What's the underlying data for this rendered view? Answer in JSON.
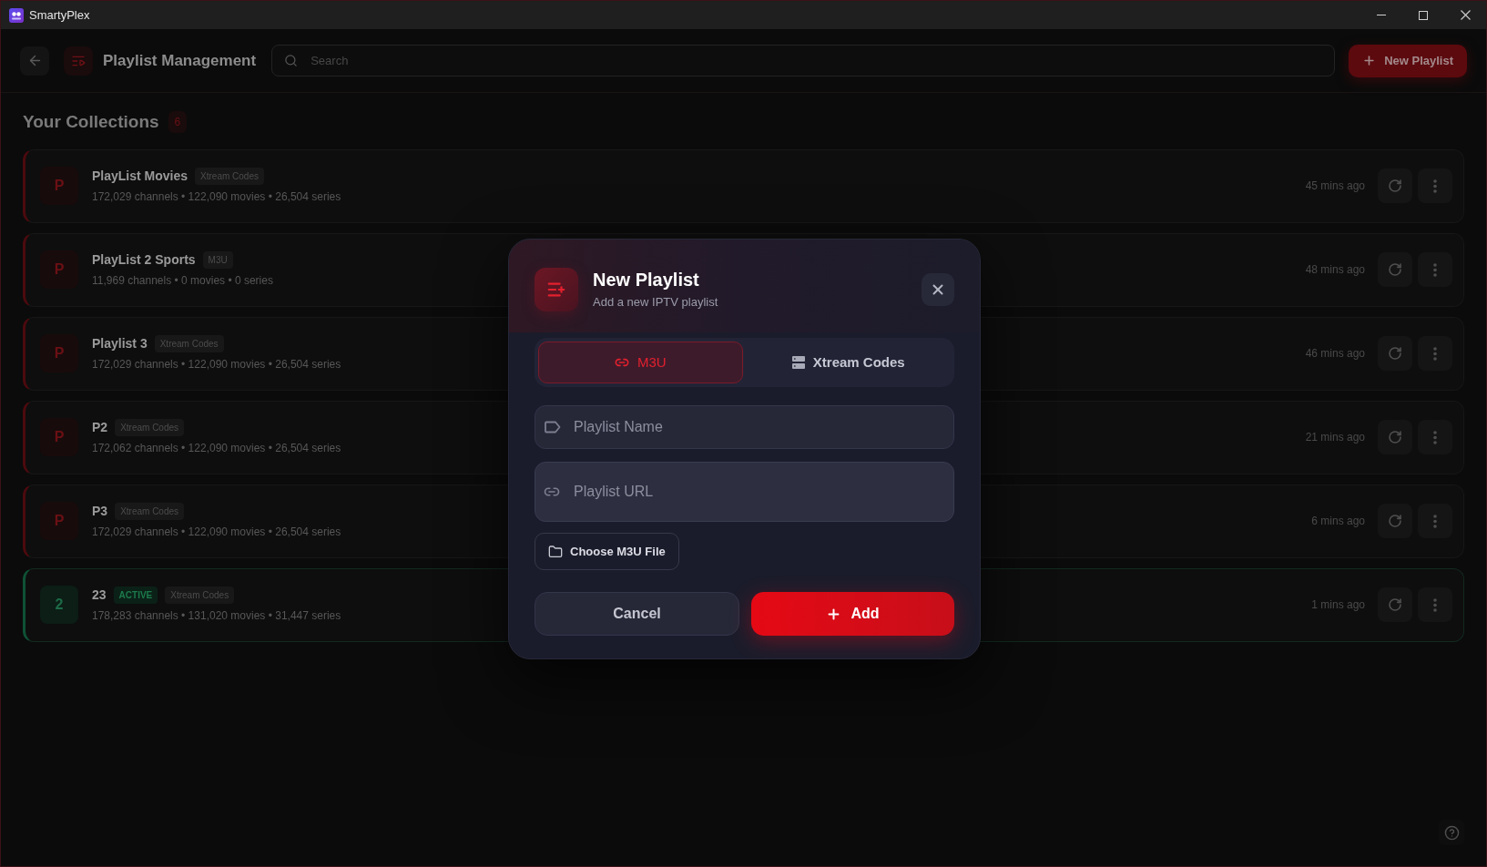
{
  "window": {
    "title": "SmartyPlex"
  },
  "header": {
    "title": "Playlist Management",
    "search": {
      "placeholder": "Search"
    },
    "new_playlist_button": {
      "label": "New Playlist"
    }
  },
  "collections": {
    "title": "Your Collections",
    "count": "6",
    "items": [
      {
        "avatar": "P",
        "name": "PlayList Movies",
        "active": false,
        "badges": [
          {
            "kind": "type",
            "label": "Xtream Codes"
          }
        ],
        "stats": "172,029 channels • 122,090 movies • 26,504 series",
        "updated": "45 mins ago"
      },
      {
        "avatar": "P",
        "name": "PlayList 2 Sports",
        "active": false,
        "badges": [
          {
            "kind": "type",
            "label": "M3U"
          }
        ],
        "stats": "11,969 channels • 0 movies • 0 series",
        "updated": "48 mins ago"
      },
      {
        "avatar": "P",
        "name": "Playlist 3",
        "active": false,
        "badges": [
          {
            "kind": "type",
            "label": "Xtream Codes"
          }
        ],
        "stats": "172,029 channels • 122,090 movies • 26,504 series",
        "updated": "46 mins ago"
      },
      {
        "avatar": "P",
        "name": "P2",
        "active": false,
        "badges": [
          {
            "kind": "type",
            "label": "Xtream Codes"
          }
        ],
        "stats": "172,062 channels • 122,090 movies • 26,504 series",
        "updated": "21 mins ago"
      },
      {
        "avatar": "P",
        "name": "P3",
        "active": false,
        "badges": [
          {
            "kind": "type",
            "label": "Xtream Codes"
          }
        ],
        "stats": "172,029 channels • 122,090 movies • 26,504 series",
        "updated": "6 mins ago"
      },
      {
        "avatar": "2",
        "name": "23",
        "active": true,
        "badges": [
          {
            "kind": "status",
            "label": "ACTIVE"
          },
          {
            "kind": "type",
            "label": "Xtream Codes"
          }
        ],
        "stats": "178,283 channels • 131,020 movies • 31,447 series",
        "updated": "1 mins ago"
      }
    ]
  },
  "modal": {
    "title": "New Playlist",
    "subtitle": "Add a new IPTV playlist",
    "tabs": [
      {
        "label": "M3U",
        "selected": true
      },
      {
        "label": "Xtream Codes",
        "selected": false
      }
    ],
    "fields": [
      {
        "kind": "single",
        "placeholder": "Playlist Name"
      },
      {
        "kind": "tall",
        "placeholder": "Playlist URL"
      }
    ],
    "file_button": {
      "label": "Choose M3U File"
    },
    "cancel_button": {
      "label": "Cancel"
    },
    "add_button": {
      "label": "Add"
    }
  }
}
